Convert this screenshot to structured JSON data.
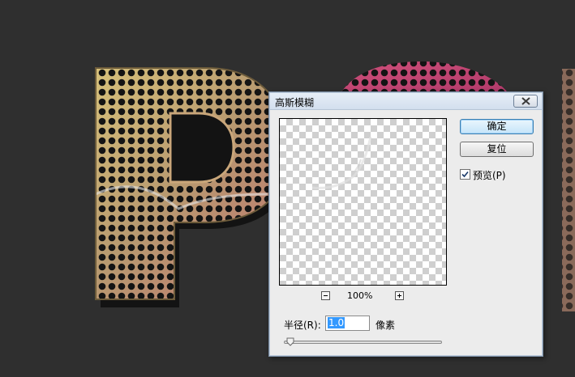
{
  "dialog": {
    "title": "高斯模糊",
    "ok_label": "确定",
    "reset_label": "复位",
    "preview_label": "预览(P)",
    "preview_checked": true,
    "zoom_level": "100%",
    "radius_label": "半径(R):",
    "radius_value": "1.0",
    "unit_label": "像素"
  },
  "icons": {
    "close": "close-icon",
    "zoom_out": "zoom-out-icon",
    "zoom_in": "zoom-in-icon",
    "check": "checkmark-icon",
    "slider": "slider-thumb-icon"
  },
  "colors": {
    "background": "#2f2f2f",
    "dialog_bg": "#ececec",
    "selection": "#3399ff"
  }
}
